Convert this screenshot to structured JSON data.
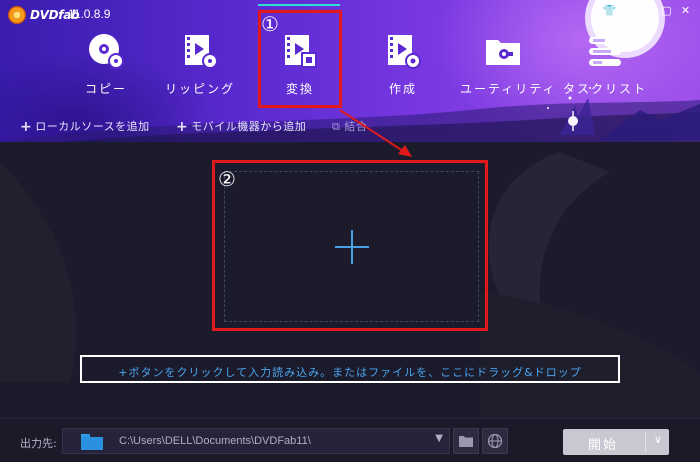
{
  "app": {
    "brand": "DVDfab",
    "version": "11.0.8.9"
  },
  "window_controls": [
    {
      "name": "shirt-icon",
      "glyph": "👕"
    },
    {
      "name": "dropdown-icon",
      "glyph": "▾"
    },
    {
      "name": "minimize-icon",
      "glyph": "—"
    },
    {
      "name": "maximize-icon",
      "glyph": "▢"
    },
    {
      "name": "close-icon",
      "glyph": "✕"
    }
  ],
  "toolbar": {
    "copy": "コピー",
    "ripping": "リッピング",
    "convert": "変換",
    "create": "作成",
    "utility": "ユーティリティ",
    "tasklist": "タスクリスト"
  },
  "actions": {
    "add_local_source": "ローカルソースを追加",
    "add_mobile_device": "モバイル機器から追加",
    "merge": "結合"
  },
  "drop_zone": {
    "hint": "+ボタンをクリックして入力読み込み。またはファイルを、ここにドラッグ&ドロップ"
  },
  "callouts": {
    "one": "①",
    "two": "②"
  },
  "output": {
    "label": "出力先:",
    "path": "C:\\Users\\DELL\\Documents\\DVDFab11\\"
  },
  "start_button": {
    "label": "開始"
  },
  "colors": {
    "header_gradient_start": "#3a1cae",
    "header_gradient_end": "#9c4fea",
    "accent_cyan": "#2fe0d0",
    "hint_blue": "#4aa5f0",
    "callout_red": "#e01a1a",
    "folder_blue": "#2a90e0"
  }
}
